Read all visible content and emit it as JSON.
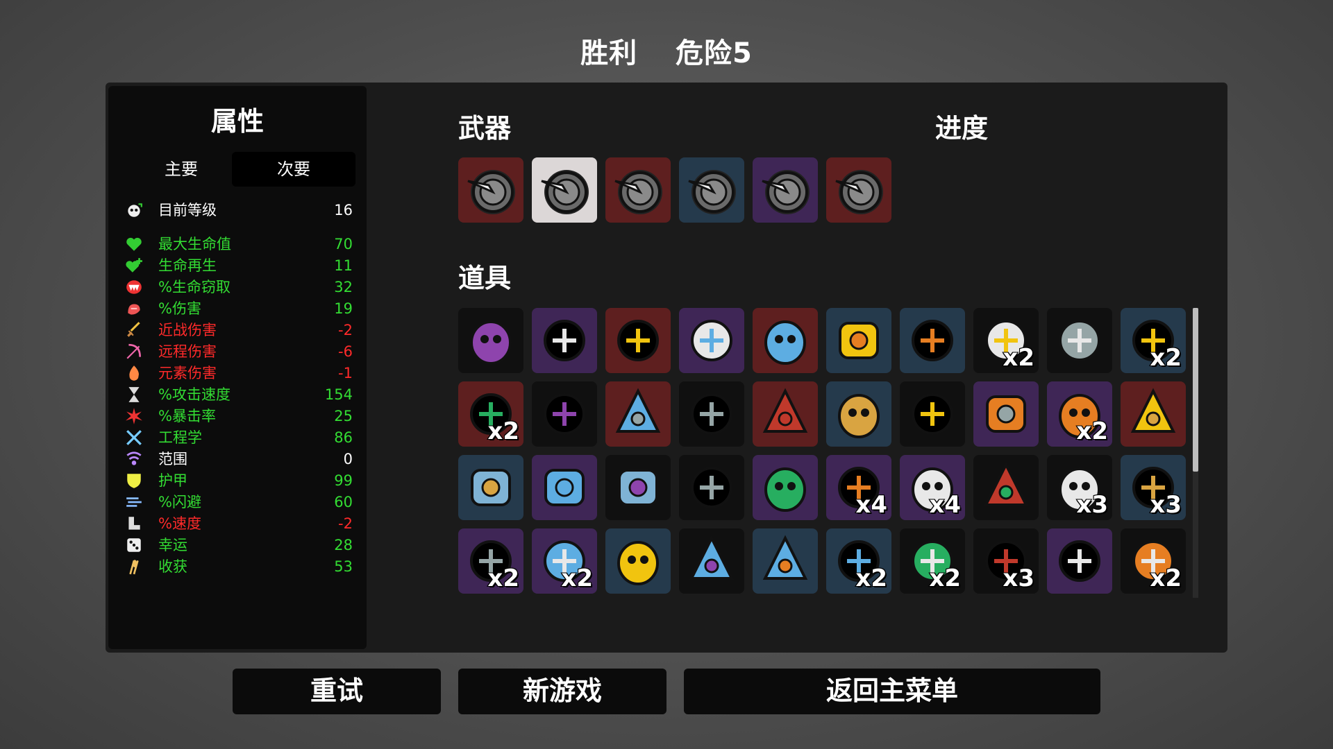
{
  "header": {
    "result": "胜利",
    "danger": "危险5"
  },
  "stats": {
    "title": "属性",
    "tabs": {
      "primary": "主要",
      "secondary": "次要"
    },
    "level": {
      "label": "目前等级",
      "value": "16",
      "color": "#ffffff",
      "icon": "skull-level-icon"
    },
    "rows": [
      {
        "label": "最大生命值",
        "value": "70",
        "color": "#33dd33",
        "icon": "heart-icon"
      },
      {
        "label": "生命再生",
        "value": "11",
        "color": "#33dd33",
        "icon": "heart-plus-icon"
      },
      {
        "label": "%生命窃取",
        "value": "32",
        "color": "#33dd33",
        "icon": "vampire-mouth-icon"
      },
      {
        "label": "%伤害",
        "value": "19",
        "color": "#33dd33",
        "icon": "muscle-icon"
      },
      {
        "label": "近战伤害",
        "value": "-2",
        "color": "#ff2a2a",
        "icon": "sword-icon"
      },
      {
        "label": "远程伤害",
        "value": "-6",
        "color": "#ff2a2a",
        "icon": "bow-icon"
      },
      {
        "label": "元素伤害",
        "value": "-1",
        "color": "#ff2a2a",
        "icon": "flame-icon"
      },
      {
        "label": "%攻击速度",
        "value": "154",
        "color": "#33dd33",
        "icon": "hourglass-icon"
      },
      {
        "label": "%暴击率",
        "value": "25",
        "color": "#33dd33",
        "icon": "crit-burst-icon"
      },
      {
        "label": "工程学",
        "value": "86",
        "color": "#33dd33",
        "icon": "wrench-cross-icon"
      },
      {
        "label": "范围",
        "value": "0",
        "color": "#ffffff",
        "icon": "range-waves-icon"
      },
      {
        "label": "护甲",
        "value": "99",
        "color": "#33dd33",
        "icon": "shield-icon"
      },
      {
        "label": "%闪避",
        "value": "60",
        "color": "#33dd33",
        "icon": "dodge-wind-icon"
      },
      {
        "label": "%速度",
        "value": "-2",
        "color": "#ff2a2a",
        "icon": "boot-icon"
      },
      {
        "label": "幸运",
        "value": "28",
        "color": "#33dd33",
        "icon": "dice-icon"
      },
      {
        "label": "收获",
        "value": "53",
        "color": "#33dd33",
        "icon": "wheat-icon"
      }
    ]
  },
  "weapons": {
    "title": "武器",
    "items": [
      {
        "icon": "spiked-shield-icon",
        "tier_color": "#5e1f1f"
      },
      {
        "icon": "spiked-shield-icon",
        "tier_color": "#dcd7d7"
      },
      {
        "icon": "spiked-shield-icon",
        "tier_color": "#5e1f1f"
      },
      {
        "icon": "spiked-shield-icon",
        "tier_color": "#253a4c"
      },
      {
        "icon": "spiked-shield-icon",
        "tier_color": "#3f2656"
      },
      {
        "icon": "spiked-shield-icon",
        "tier_color": "#5e1f1f"
      }
    ]
  },
  "progress": {
    "title": "进度"
  },
  "items": {
    "title": "道具",
    "rows": [
      [
        {
          "icon": "egg-glasses-icon",
          "bg": "#101010",
          "qty": ""
        },
        {
          "icon": "angel-wings-icon",
          "bg": "#3f2656",
          "qty": ""
        },
        {
          "icon": "spiky-blob-icon",
          "bg": "#5e1f1f",
          "qty": ""
        },
        {
          "icon": "cannon-icon",
          "bg": "#3f2656",
          "qty": ""
        },
        {
          "icon": "sparkle-wand-icon",
          "bg": "#5e1f1f",
          "qty": ""
        },
        {
          "icon": "ring-icon",
          "bg": "#253a4c",
          "qty": ""
        },
        {
          "icon": "stone-crown-icon",
          "bg": "#253a4c",
          "qty": ""
        },
        {
          "icon": "treasure-map-icon",
          "bg": "#101010",
          "qty": "x2"
        },
        {
          "icon": "eyes-icon",
          "bg": "#101010",
          "qty": ""
        },
        {
          "icon": "amulet-icon",
          "bg": "#253a4c",
          "qty": "x2"
        }
      ],
      [
        {
          "icon": "robot-arm-icon",
          "bg": "#5e1f1f",
          "qty": "x2"
        },
        {
          "icon": "crazy-hamster-icon",
          "bg": "#101010",
          "qty": ""
        },
        {
          "icon": "snow-globe-icon",
          "bg": "#5e1f1f",
          "qty": ""
        },
        {
          "icon": "tree-icon",
          "bg": "#101010",
          "qty": ""
        },
        {
          "icon": "potato-icon",
          "bg": "#5e1f1f",
          "qty": ""
        },
        {
          "icon": "dark-glasses-icon",
          "bg": "#253a4c",
          "qty": ""
        },
        {
          "icon": "fang-icon",
          "bg": "#101010",
          "qty": ""
        },
        {
          "icon": "mortar-herb-icon",
          "bg": "#3f2656",
          "qty": ""
        },
        {
          "icon": "toolbox-icon",
          "bg": "#3f2656",
          "qty": "x2"
        },
        {
          "icon": "red-hoodie-icon",
          "bg": "#5e1f1f",
          "qty": ""
        }
      ],
      [
        {
          "icon": "white-flag-icon",
          "bg": "#253a4c",
          "qty": ""
        },
        {
          "icon": "pink-jelly-icon",
          "bg": "#3f2656",
          "qty": ""
        },
        {
          "icon": "witch-mushroom-icon",
          "bg": "#101010",
          "qty": ""
        },
        {
          "icon": "ghost-tooth-icon",
          "bg": "#101010",
          "qty": ""
        },
        {
          "icon": "halo-drone-icon",
          "bg": "#3f2656",
          "qty": ""
        },
        {
          "icon": "tardigrade-icon",
          "bg": "#3f2656",
          "qty": "x4"
        },
        {
          "icon": "pilot-bot-icon",
          "bg": "#3f2656",
          "qty": "x4"
        },
        {
          "icon": "monkey-icon",
          "bg": "#101010",
          "qty": ""
        },
        {
          "icon": "ghost-flag-icon",
          "bg": "#101010",
          "qty": "x3"
        },
        {
          "icon": "leech-icon",
          "bg": "#253a4c",
          "qty": "x3"
        }
      ],
      [
        {
          "icon": "baby-snowman-icon",
          "bg": "#3f2656",
          "qty": "x2"
        },
        {
          "icon": "turret-icon",
          "bg": "#3f2656",
          "qty": "x2"
        },
        {
          "icon": "compass-icon",
          "bg": "#253a4c",
          "qty": ""
        },
        {
          "icon": "coal-icon",
          "bg": "#101010",
          "qty": ""
        },
        {
          "icon": "garden-machine-icon",
          "bg": "#253a4c",
          "qty": ""
        },
        {
          "icon": "medic-turret-icon",
          "bg": "#253a4c",
          "qty": "x2"
        },
        {
          "icon": "bird-lamp-icon",
          "bg": "#101010",
          "qty": "x2"
        },
        {
          "icon": "scarf-icon",
          "bg": "#101010",
          "qty": "x3"
        },
        {
          "icon": "gift-box-icon",
          "bg": "#3f2656",
          "qty": ""
        },
        {
          "icon": "gear-turret-icon",
          "bg": "#101010",
          "qty": "x2"
        }
      ]
    ]
  },
  "buttons": {
    "retry": "重试",
    "new_game": "新游戏",
    "main_menu": "返回主菜单"
  }
}
